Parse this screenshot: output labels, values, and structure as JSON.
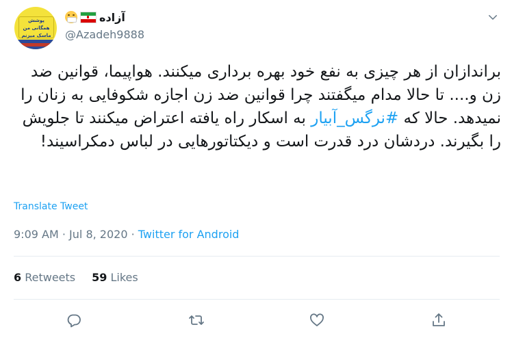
{
  "user": {
    "display_name": "آزاده",
    "handle": "@Azadeh9888",
    "avatar_sign_text": "پوشش همگانی من ماسک میزنم"
  },
  "tweet": {
    "text_before_hashtag": "براندازان از هر چیزی به نفع خود بهره برداری میکنند. هواپیما، قوانین ضد زن و.... تا حالا مدام میگفتند چرا قوانین ضد زن اجازه شکوفایی به زنان را نمیدهد. حالا که ",
    "hashtag": "#نرگس_آبیار",
    "text_after_hashtag": " به اسکار راه یافته اعتراض میکنند تا جلویش را بگیرند. دردشان درد قدرت است و دیکتاتورهایی در لباس دمکراسیند!",
    "translate_label": "Translate Tweet",
    "time": "9:09 AM",
    "separator": "·",
    "date": "Jul 8, 2020",
    "source": "Twitter for Android"
  },
  "stats": {
    "retweets_count": "6",
    "retweets_label": "Retweets",
    "likes_count": "59",
    "likes_label": "Likes"
  },
  "icons": {
    "reply": "reply-icon",
    "retweet": "retweet-icon",
    "like": "heart-icon",
    "share": "share-icon",
    "more": "chevron-down-icon"
  },
  "colors": {
    "accent": "#1da1f2",
    "secondary_text": "#657786",
    "primary_text": "#14171a",
    "divider": "#e6ecf0"
  }
}
